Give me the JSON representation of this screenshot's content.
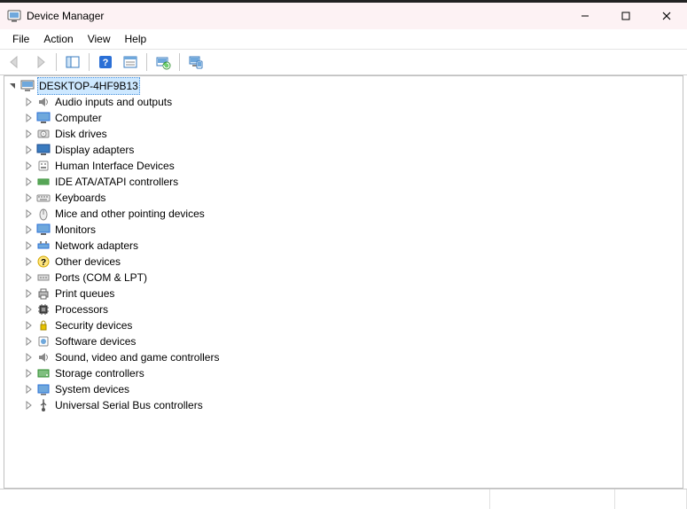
{
  "title": "Device Manager",
  "window_controls": {
    "min": "minimize",
    "max": "maximize",
    "close": "close"
  },
  "menus": [
    "File",
    "Action",
    "View",
    "Help"
  ],
  "toolbar": [
    {
      "id": "back",
      "name": "back-button",
      "enabled": false
    },
    {
      "id": "forward",
      "name": "forward-button",
      "enabled": false
    },
    {
      "id": "sep"
    },
    {
      "id": "show-hide",
      "name": "show-hide-tree-button",
      "enabled": true
    },
    {
      "id": "sep"
    },
    {
      "id": "help",
      "name": "help-button",
      "enabled": true
    },
    {
      "id": "properties",
      "name": "properties-button",
      "enabled": true
    },
    {
      "id": "sep"
    },
    {
      "id": "scan",
      "name": "scan-hardware-button",
      "enabled": true
    },
    {
      "id": "sep"
    },
    {
      "id": "devices",
      "name": "devices-view-button",
      "enabled": true
    }
  ],
  "root": {
    "label": "DESKTOP-4HF9B13",
    "icon": "computer-icon",
    "expanded": true,
    "selected": true,
    "children": [
      {
        "label": "Audio inputs and outputs",
        "icon": "audio-icon"
      },
      {
        "label": "Computer",
        "icon": "monitor-icon"
      },
      {
        "label": "Disk drives",
        "icon": "disk-icon"
      },
      {
        "label": "Display adapters",
        "icon": "display-icon"
      },
      {
        "label": "Human Interface Devices",
        "icon": "hid-icon"
      },
      {
        "label": "IDE ATA/ATAPI controllers",
        "icon": "ide-icon"
      },
      {
        "label": "Keyboards",
        "icon": "keyboard-icon"
      },
      {
        "label": "Mice and other pointing devices",
        "icon": "mouse-icon"
      },
      {
        "label": "Monitors",
        "icon": "monitor-icon"
      },
      {
        "label": "Network adapters",
        "icon": "network-icon"
      },
      {
        "label": "Other devices",
        "icon": "other-icon"
      },
      {
        "label": "Ports (COM & LPT)",
        "icon": "port-icon"
      },
      {
        "label": "Print queues",
        "icon": "printer-icon"
      },
      {
        "label": "Processors",
        "icon": "processor-icon"
      },
      {
        "label": "Security devices",
        "icon": "security-icon"
      },
      {
        "label": "Software devices",
        "icon": "software-icon"
      },
      {
        "label": "Sound, video and game controllers",
        "icon": "audio-icon"
      },
      {
        "label": "Storage controllers",
        "icon": "storage-icon"
      },
      {
        "label": "System devices",
        "icon": "system-icon"
      },
      {
        "label": "Universal Serial Bus controllers",
        "icon": "usb-icon"
      }
    ]
  }
}
